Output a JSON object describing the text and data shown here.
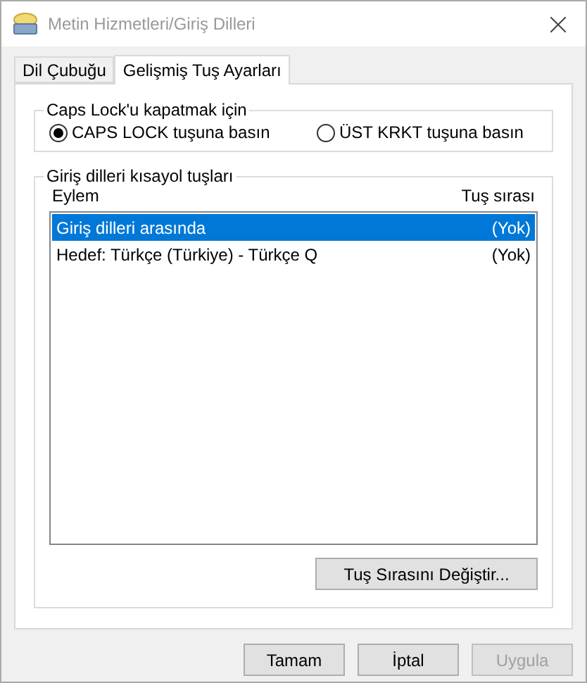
{
  "window": {
    "title": "Metin Hizmetleri/Giriş Dilleri"
  },
  "tabs": [
    {
      "label": "Dil Çubuğu",
      "selected": false
    },
    {
      "label": "Gelişmiş Tuş Ayarları",
      "selected": true
    }
  ],
  "caps_lock_group": {
    "title": "Caps Lock'u kapatmak için",
    "options": [
      {
        "label": "CAPS LOCK tuşuna basın",
        "selected": true
      },
      {
        "label": "ÜST KRKT tuşuna basın",
        "selected": false
      }
    ]
  },
  "hotkeys_group": {
    "title": "Giriş dilleri kısayol tuşları",
    "columns": [
      "Eylem",
      "Tuş sırası"
    ],
    "rows": [
      {
        "action": "Giriş dilleri arasında",
        "keys": "(Yok)",
        "selected": true
      },
      {
        "action": "Hedef: Türkçe (Türkiye) - Türkçe Q",
        "keys": "(Yok)",
        "selected": false
      }
    ],
    "change_button": "Tuş Sırasını Değiştir..."
  },
  "buttons": [
    {
      "label": "Tamam",
      "disabled": false
    },
    {
      "label": "İptal",
      "disabled": false
    },
    {
      "label": "Uygula",
      "disabled": true
    }
  ]
}
